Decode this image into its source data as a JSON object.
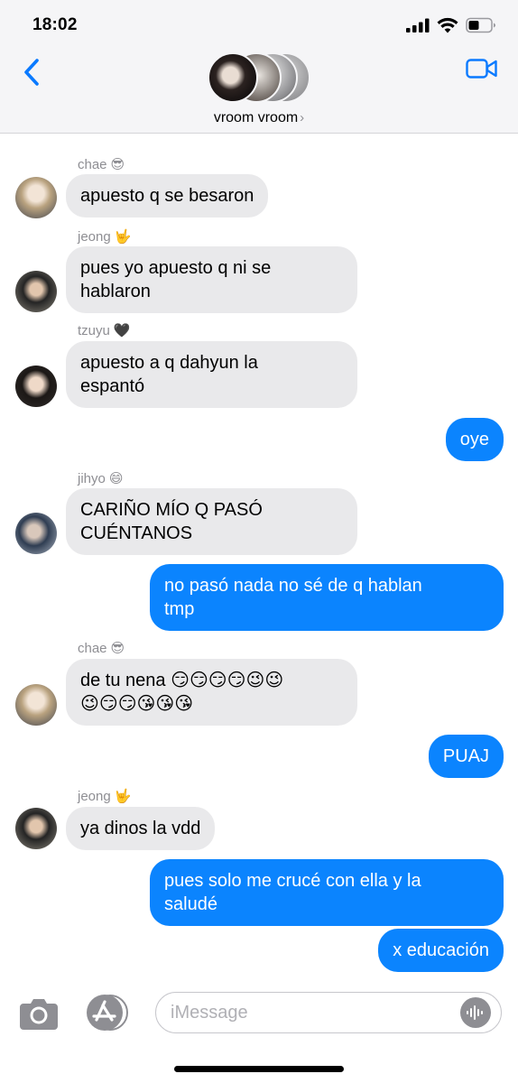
{
  "status_bar": {
    "time": "18:02"
  },
  "header": {
    "group_name": "vroom vroom",
    "chevron": "›"
  },
  "colors": {
    "outgoing": "#0b84fe",
    "incoming": "#e9e9eb",
    "accent": "#0a7aff"
  },
  "messages": [
    {
      "type": "sender",
      "name": "chae",
      "emoji": "😎"
    },
    {
      "type": "in",
      "text": "apuesto q se besaron"
    },
    {
      "type": "sender",
      "name": "jeong",
      "emoji": "🤟"
    },
    {
      "type": "in",
      "text": "pues yo apuesto q ni se\nhablaron"
    },
    {
      "type": "sender",
      "name": "tzuyu",
      "emoji": "🖤"
    },
    {
      "type": "in",
      "text": "apuesto a q dahyun la\nespantó"
    },
    {
      "type": "out",
      "text": "oye"
    },
    {
      "type": "sender",
      "name": "jihyo",
      "emoji": "😄"
    },
    {
      "type": "in",
      "text": "CARIÑO MÍO Q PASÓ\nCUÉNTANOS"
    },
    {
      "type": "out",
      "text": "no pasó nada no sé de q hablan\ntmp"
    },
    {
      "type": "sender",
      "name": "chae",
      "emoji": "😎"
    },
    {
      "type": "in",
      "text": "de tu nena 😏😏😏😏😉😉\n😉😏😏😘😘😘"
    },
    {
      "type": "out",
      "text": "PUAJ"
    },
    {
      "type": "sender",
      "name": "jeong",
      "emoji": "🤟"
    },
    {
      "type": "in",
      "text": "ya dinos la vdd"
    },
    {
      "type": "out",
      "text": "pues solo me crucé con ella y la\nsaludé"
    },
    {
      "type": "out",
      "text": "x educación"
    }
  ],
  "input": {
    "placeholder": "iMessage",
    "value": ""
  },
  "icons": {
    "back": "chevron-left-icon",
    "video": "video-camera-icon",
    "camera": "camera-icon",
    "appstore": "app-store-icon",
    "audio": "waveform-icon"
  }
}
